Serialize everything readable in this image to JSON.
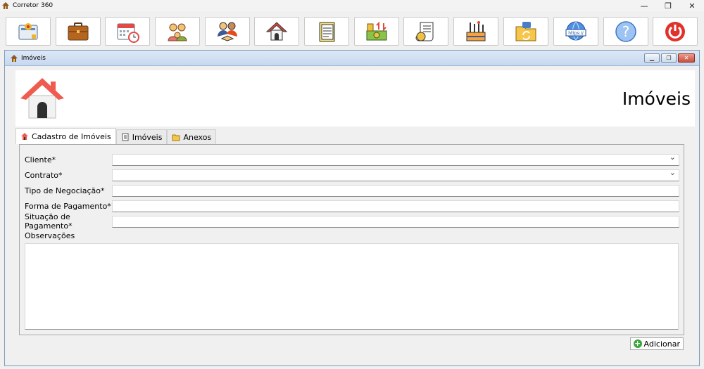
{
  "app": {
    "title": "Corretor 360"
  },
  "window_controls": {
    "minimize": "—",
    "restore": "❐",
    "close": "✕"
  },
  "toolbar": {
    "buttons": [
      {
        "name": "contracts-icon"
      },
      {
        "name": "briefcase-icon"
      },
      {
        "name": "calendar-icon"
      },
      {
        "name": "family-icon"
      },
      {
        "name": "handshake-icon"
      },
      {
        "name": "house-icon"
      },
      {
        "name": "notebook-icon"
      },
      {
        "name": "money-transfer-icon"
      },
      {
        "name": "invoice-icon"
      },
      {
        "name": "tools-icon"
      },
      {
        "name": "backup-folder-icon"
      },
      {
        "name": "https-globe-icon"
      },
      {
        "name": "help-icon"
      },
      {
        "name": "power-icon"
      }
    ]
  },
  "mdi": {
    "title": "Imóveis",
    "controls": {
      "minimize": "▁",
      "restore": "❐",
      "close": "✕"
    }
  },
  "header": {
    "title": "Imóveis"
  },
  "tabs": [
    {
      "label": "Cadastro de Imóveis",
      "active": true
    },
    {
      "label": "Imóveis",
      "active": false
    },
    {
      "label": "Anexos",
      "active": false
    }
  ],
  "form": {
    "cliente_label": "Cliente*",
    "contrato_label": "Contrato*",
    "tipo_label": "Tipo de Negociação*",
    "forma_label": "Forma de Pagamento*",
    "situacao_label": "Situação de Pagamento*",
    "observacoes_label": "Observações",
    "cliente_value": "",
    "contrato_value": "",
    "tipo_value": "",
    "forma_value": "",
    "situacao_value": "",
    "observacoes_value": ""
  },
  "actions": {
    "add_label": "Adicionar"
  },
  "colors": {
    "accent_red": "#e04a3f",
    "help_blue": "#6fa8e8",
    "add_green": "#3aa53a"
  }
}
